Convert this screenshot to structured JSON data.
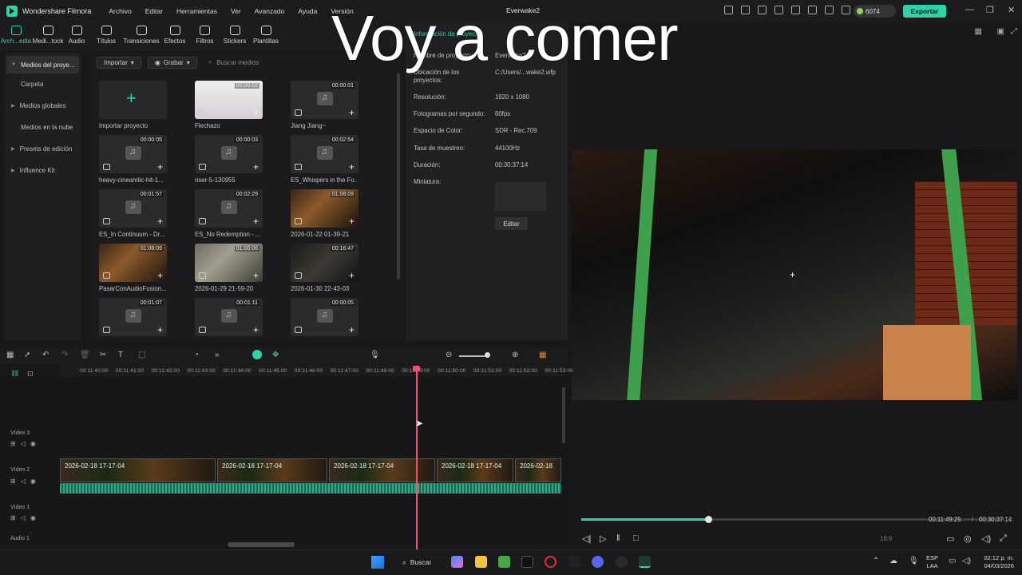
{
  "app": {
    "name": "Wondershare Filmora",
    "project_title": "Everwake2",
    "credits": "6074",
    "export_label": "Exportar"
  },
  "menu": [
    "Archivo",
    "Editar",
    "Herramientas",
    "Ver",
    "Avanzado",
    "Ayuda",
    "Versión"
  ],
  "toolbar": [
    {
      "label": "Arch...edia",
      "icon": "media-icon"
    },
    {
      "label": "Medi...tock",
      "icon": "stock-icon"
    },
    {
      "label": "Audio",
      "icon": "audio-icon"
    },
    {
      "label": "Títulos",
      "icon": "titles-icon"
    },
    {
      "label": "Transiciones",
      "icon": "transitions-icon"
    },
    {
      "label": "Efectos",
      "icon": "effects-icon"
    },
    {
      "label": "Filtros",
      "icon": "filters-icon"
    },
    {
      "label": "Stickers",
      "icon": "stickers-icon"
    },
    {
      "label": "Plantillas",
      "icon": "templates-icon"
    }
  ],
  "sidebar": [
    "Medios del proye...",
    "Carpeta",
    "Medios globales",
    "Medios en la nube",
    "Presets de edición",
    "Influence Kit"
  ],
  "media_bar": {
    "import": "Importar",
    "record": "Grabar",
    "search_placeholder": "Buscar medios"
  },
  "media": [
    {
      "name": "Importar proyecto",
      "dur": "",
      "kind": "import"
    },
    {
      "name": "Flechazo",
      "dur": "00:00:02",
      "kind": "anime"
    },
    {
      "name": "Jiang Jiang~",
      "dur": "00:00:01",
      "kind": "audio"
    },
    {
      "name": "heavy-cineamtic-hit-1...",
      "dur": "00:00:05",
      "kind": "audio"
    },
    {
      "name": "riser-5-130955",
      "dur": "00:00:03",
      "kind": "audio"
    },
    {
      "name": "ES_Whispers in the Fo...",
      "dur": "00:02:54",
      "kind": "audio"
    },
    {
      "name": "ES_In Continuum - Dr...",
      "dur": "00:01:57",
      "kind": "audio"
    },
    {
      "name": "ES_No Redemption - ...",
      "dur": "00:02:29",
      "kind": "audio"
    },
    {
      "name": "2026-01-22 01-39-21",
      "dur": "01:08:09",
      "kind": "video"
    },
    {
      "name": "PasarConAudioFusion...",
      "dur": "01:08:09",
      "kind": "video"
    },
    {
      "name": "2026-01-29 21-59-20",
      "dur": "01:00:06",
      "kind": "light"
    },
    {
      "name": "2026-01-30 22-43-03",
      "dur": "00:16:47",
      "kind": "dark"
    },
    {
      "name": "",
      "dur": "00:01:07",
      "kind": "audio"
    },
    {
      "name": "",
      "dur": "00:01:11",
      "kind": "audio"
    },
    {
      "name": "",
      "dur": "00:00:05",
      "kind": "audio"
    }
  ],
  "project_info": {
    "header": "Información de proyecto",
    "rows": [
      {
        "label": "Nombre de proyecto:",
        "value": "Everwake2"
      },
      {
        "label": "Ubicación de los proyectos:",
        "value": "C:/Users/...wake2.wfp"
      },
      {
        "label": "Resolución:",
        "value": "1920 x 1080"
      },
      {
        "label": "Fotogramas por segundo:",
        "value": "60fps"
      },
      {
        "label": "Espacio de Color:",
        "value": "SDR - Rec.709"
      },
      {
        "label": "Tasa de muestreo:",
        "value": "44100Hz"
      },
      {
        "label": "Duración:",
        "value": "00:30:37:14"
      },
      {
        "label": "Miniatura:",
        "value": ""
      }
    ],
    "edit_label": "Editar"
  },
  "overlay_caption": "Voy a comer",
  "preview": {
    "current_time": "00:11:49:25",
    "total_time": "00:30:37:14",
    "ratio": "16:9",
    "progress": 0.3
  },
  "ruler": [
    "00:11:40:00",
    "00:11:41:00",
    "00:11:42:00",
    "00:11:43:00",
    "00:11:44:00",
    "00:11:45:00",
    "00:11:46:00",
    "00:11:47:00",
    "00:11:48:00",
    "00:11:49:00",
    "00:11:50:00",
    "00:11:51:00",
    "00:11:52:00",
    "00:11:53:00"
  ],
  "tracks": [
    "Vídeo 3",
    "Vídeo 2",
    "Vídeo 1",
    "Audio 1"
  ],
  "clips": [
    "2026-02-18 17-17-04",
    "2026-02-18 17-17-04",
    "2026-02-18 17-17-04",
    "2026-02-18 17-17-04",
    "2026-02-18"
  ],
  "taskbar": {
    "search": "Buscar",
    "lang1": "ESP",
    "lang2": "LAA",
    "time": "02:12 p. m.",
    "date": "04/03/2026"
  }
}
